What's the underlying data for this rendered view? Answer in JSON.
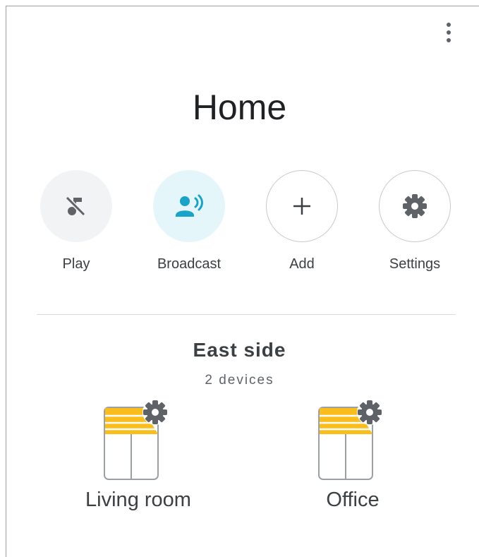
{
  "header": {
    "title": "Home",
    "menu_icon": "more-vert-icon"
  },
  "actions": [
    {
      "label": "Play",
      "icon": "music-off-icon"
    },
    {
      "label": "Broadcast",
      "icon": "broadcast-icon"
    },
    {
      "label": "Add",
      "icon": "plus-icon"
    },
    {
      "label": "Settings",
      "icon": "gear-icon"
    }
  ],
  "section": {
    "title": "East side",
    "subtitle": "2 devices"
  },
  "rooms": [
    {
      "label": "Living room",
      "icon": "room-door-icon",
      "badge_icon": "gear-icon"
    },
    {
      "label": "Office",
      "icon": "room-door-icon",
      "badge_icon": "gear-icon"
    }
  ],
  "colors": {
    "broadcast_accent": "#1aa3c9",
    "broadcast_bg": "#e4f6fa",
    "room_stripe": "#f9be1b",
    "icon_gray": "#5f6368"
  }
}
